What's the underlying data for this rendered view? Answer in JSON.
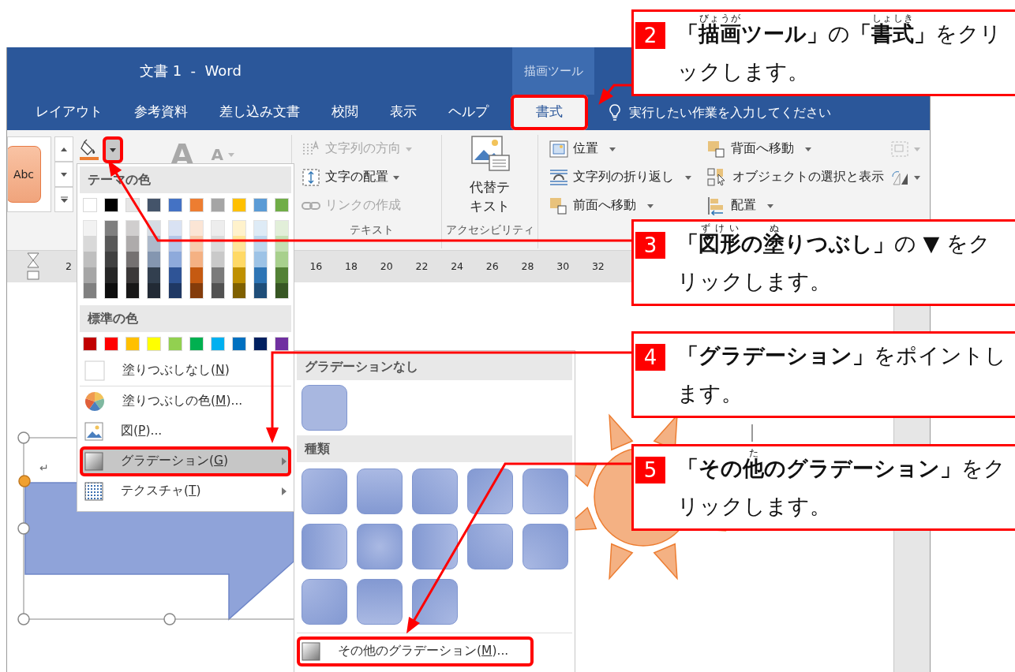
{
  "window": {
    "title": "文書 1  -  Word",
    "contextual_tab": "描画ツール"
  },
  "tabs": [
    {
      "label": "レイアウト",
      "selected": false,
      "highlighted": false
    },
    {
      "label": "参考資料",
      "selected": false,
      "highlighted": false
    },
    {
      "label": "差し込み文書",
      "selected": false,
      "highlighted": false
    },
    {
      "label": "校閲",
      "selected": false,
      "highlighted": false
    },
    {
      "label": "表示",
      "selected": false,
      "highlighted": false
    },
    {
      "label": "ヘルプ",
      "selected": false,
      "highlighted": false
    },
    {
      "label": "書式",
      "selected": true,
      "highlighted": true
    }
  ],
  "tell_me": {
    "placeholder": "実行したい作業を入力してください"
  },
  "ribbon": {
    "style_sample": "Abc",
    "fill_dropdown_highlighted": true,
    "text_effects": [
      {
        "glyph": "A",
        "kind": "large",
        "disabled": true
      },
      {
        "glyph": "A",
        "kind": "small",
        "disabled": true
      }
    ],
    "text_group": {
      "label": "テキスト",
      "items": [
        {
          "label": "文字列の方向",
          "disabled": true,
          "dropdown": true
        },
        {
          "label": "文字の配置",
          "disabled": false,
          "dropdown": true
        },
        {
          "label": "リンクの作成",
          "disabled": true,
          "dropdown": false
        }
      ]
    },
    "accessibility_group": {
      "label": "アクセシビリティ",
      "button": "代替テキスト"
    },
    "arrange_columns": [
      [
        {
          "label": "位置",
          "dropdown": true
        },
        {
          "label": "文字列の折り返し",
          "dropdown": true
        },
        {
          "label": "前面へ移動",
          "dropdown": true
        }
      ],
      [
        {
          "label": "背面へ移動",
          "dropdown": true
        },
        {
          "label": "オブジェクトの選択と表示"
        },
        {
          "label": "配置",
          "dropdown": true
        }
      ]
    ]
  },
  "ruler": {
    "left_number": "2",
    "numbers": [
      "16",
      "18",
      "20",
      "22",
      "24",
      "26",
      "28",
      "30",
      "32"
    ]
  },
  "document": {
    "paragraph_mark": "↵"
  },
  "fill_menu": {
    "theme_heading": "テーマの色",
    "theme_colors": [
      {
        "color": "#ffffff",
        "shades": [
          {
            "color": "#f2f2f2"
          },
          {
            "color": "#d9d9d9"
          },
          {
            "color": "#bfbfbf"
          },
          {
            "color": "#a6a6a6"
          },
          {
            "color": "#808080"
          }
        ]
      },
      {
        "color": "#000000",
        "shades": [
          {
            "color": "#7f7f7f"
          },
          {
            "color": "#595959"
          },
          {
            "color": "#404040"
          },
          {
            "color": "#262626"
          },
          {
            "color": "#0d0d0d"
          }
        ]
      },
      {
        "color": "#e7e6e6",
        "shades": [
          {
            "color": "#d0cece"
          },
          {
            "color": "#aeabab"
          },
          {
            "color": "#757171"
          },
          {
            "color": "#3b3838"
          },
          {
            "color": "#181717"
          }
        ]
      },
      {
        "color": "#44546a",
        "shades": [
          {
            "color": "#d6dce4"
          },
          {
            "color": "#adb9ca"
          },
          {
            "color": "#8496b0"
          },
          {
            "color": "#323f4f"
          },
          {
            "color": "#222a35"
          }
        ]
      },
      {
        "color": "#4472c4",
        "shades": [
          {
            "color": "#d9e2f3"
          },
          {
            "color": "#b4c6e7"
          },
          {
            "color": "#8eaadb"
          },
          {
            "color": "#2f5496"
          },
          {
            "color": "#1f3864"
          }
        ]
      },
      {
        "color": "#ed7d31",
        "shades": [
          {
            "color": "#fbe5d5"
          },
          {
            "color": "#f7cbac"
          },
          {
            "color": "#f4b183"
          },
          {
            "color": "#c55a11"
          },
          {
            "color": "#843c0b"
          }
        ]
      },
      {
        "color": "#a5a5a5",
        "shades": [
          {
            "color": "#ededed"
          },
          {
            "color": "#dbdbdb"
          },
          {
            "color": "#c9c9c9"
          },
          {
            "color": "#7b7b7b"
          },
          {
            "color": "#525252"
          }
        ]
      },
      {
        "color": "#ffc000",
        "shades": [
          {
            "color": "#fff2cc"
          },
          {
            "color": "#ffe599"
          },
          {
            "color": "#ffd966"
          },
          {
            "color": "#bf9000"
          },
          {
            "color": "#7f6000"
          }
        ]
      },
      {
        "color": "#5b9bd5",
        "shades": [
          {
            "color": "#deebf6"
          },
          {
            "color": "#bdd7ee"
          },
          {
            "color": "#9dc3e6"
          },
          {
            "color": "#2e75b5"
          },
          {
            "color": "#1f4e79"
          }
        ]
      },
      {
        "color": "#70ad47",
        "shades": [
          {
            "color": "#e2efd9"
          },
          {
            "color": "#c5e0b3"
          },
          {
            "color": "#a8d08d"
          },
          {
            "color": "#538135"
          },
          {
            "color": "#375623"
          }
        ]
      }
    ],
    "standard_heading": "標準の色",
    "standard_colors": [
      {
        "color": "#c00000"
      },
      {
        "color": "#ff0000"
      },
      {
        "color": "#ffc000"
      },
      {
        "color": "#ffff00"
      },
      {
        "color": "#92d050"
      },
      {
        "color": "#00b050"
      },
      {
        "color": "#00b0f0"
      },
      {
        "color": "#0070c0"
      },
      {
        "color": "#002060"
      },
      {
        "color": "#7030a0"
      }
    ],
    "items": [
      {
        "kind": "no-fill",
        "before": "塗りつぶしなし(",
        "key": "N",
        "after": ")",
        "submenu": false,
        "selected": false,
        "highlighted": false
      },
      {
        "kind": "fill-color",
        "before": "塗りつぶしの色(",
        "key": "M",
        "after": ")...",
        "submenu": false,
        "selected": false,
        "highlighted": false
      },
      {
        "kind": "picture",
        "before": "図(",
        "key": "P",
        "after": ")...",
        "submenu": false,
        "selected": false,
        "highlighted": false
      },
      {
        "kind": "gradient",
        "before": "グラデーション(",
        "key": "G",
        "after": ")",
        "submenu": true,
        "selected": true,
        "highlighted": true
      },
      {
        "kind": "texture",
        "before": "テクスチャ(",
        "key": "T",
        "after": ")",
        "submenu": true,
        "selected": false,
        "highlighted": false
      }
    ]
  },
  "gradient_menu": {
    "none_heading": "グラデーションなし",
    "variants_heading": "種類",
    "variants": [
      {
        "kind": "tl"
      },
      {
        "kind": "t"
      },
      {
        "kind": "tr"
      },
      {
        "kind": "br"
      },
      {
        "kind": "bl"
      },
      {
        "kind": "l"
      },
      {
        "kind": "c"
      },
      {
        "kind": "r"
      },
      {
        "kind": "ctr"
      },
      {
        "kind": "cbl"
      },
      {
        "kind": "ctl"
      },
      {
        "kind": "b"
      },
      {
        "kind": "cbr"
      }
    ],
    "more": {
      "before": "その他のグラデーション(",
      "key": "M",
      "after": ")...",
      "highlighted": true
    }
  },
  "callouts": [
    {
      "step": "2",
      "segments": [
        {
          "text": "「",
          "bold": true
        },
        {
          "text": "描画",
          "ruby": "びょうが",
          "bold": true
        },
        {
          "text": "ツール」",
          "bold": true
        },
        {
          "text": "の",
          "bold": false
        },
        {
          "text": "「",
          "bold": true
        },
        {
          "text": "書式",
          "ruby": "しょしき",
          "bold": true
        },
        {
          "text": "」",
          "bold": true
        },
        {
          "text": "をクリックします。",
          "bold": false
        }
      ]
    },
    {
      "step": "3",
      "segments": [
        {
          "text": "「",
          "bold": true
        },
        {
          "text": "図形",
          "ruby": "ずけい",
          "bold": true
        },
        {
          "text": "の",
          "bold": true
        },
        {
          "text": "塗",
          "ruby": "ぬ",
          "bold": true
        },
        {
          "text": "りつぶし」",
          "bold": true
        },
        {
          "text": "の ▼ をクリックします。",
          "bold": false
        }
      ]
    },
    {
      "step": "4",
      "segments": [
        {
          "text": "「グラデーション」",
          "bold": true
        },
        {
          "text": "をポイントします。",
          "bold": false
        }
      ]
    },
    {
      "step": "5",
      "segments": [
        {
          "text": "「その",
          "bold": true
        },
        {
          "text": "他",
          "ruby": "た",
          "bold": true
        },
        {
          "text": "のグラデーション」",
          "bold": true
        },
        {
          "text": "をクリックします。",
          "bold": false
        }
      ]
    }
  ]
}
